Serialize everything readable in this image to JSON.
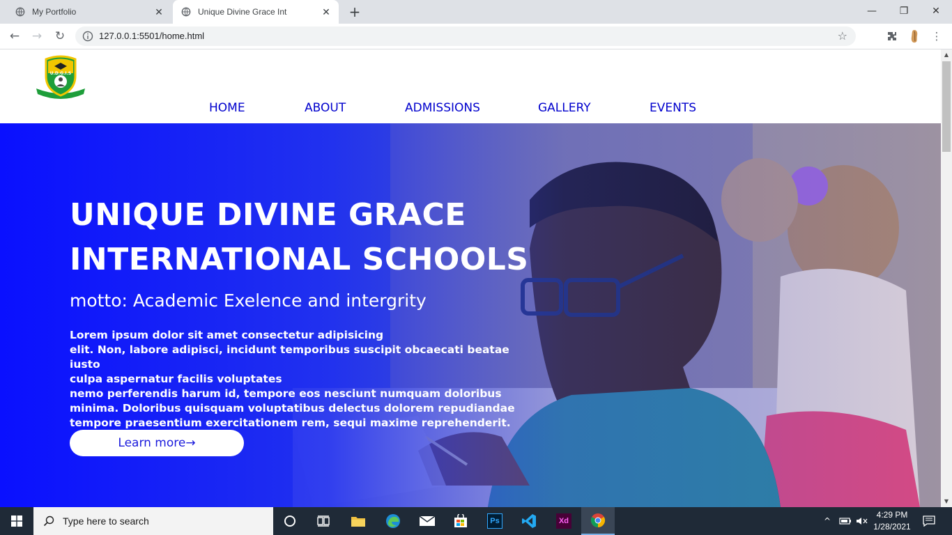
{
  "browser": {
    "tabs": [
      {
        "title": "My Portfolio",
        "active": false
      },
      {
        "title": "Unique Divine Grace Int",
        "active": true
      }
    ],
    "url": "127.0.0.1:5501/home.html"
  },
  "site": {
    "logo_text": "U.D.G.I.S",
    "nav": [
      "HOME",
      "ABOUT",
      "ADMISSIONS",
      "GALLERY",
      "EVENTS"
    ],
    "hero": {
      "title_line1": "UNIQUE DIVINE GRACE",
      "title_line2": "INTERNATIONAL SCHOOLS",
      "motto": "motto: Academic Exelence and intergrity",
      "body_lines": [
        "Lorem ipsum dolor sit amet consectetur adipisicing",
        "elit. Non, labore adipisci, incidunt temporibus suscipit obcaecati beatae iusto",
        "culpa aspernatur facilis voluptates",
        "nemo perferendis harum id, tempore eos nesciunt numquam doloribus",
        "minima. Doloribus quisquam voluptatibus delectus dolorem repudiandae",
        "tempore praesentium exercitationem rem, sequi maxime reprehenderit."
      ],
      "button": "Learn more→"
    }
  },
  "taskbar": {
    "search_placeholder": "Type here to search",
    "time": "4:29 PM",
    "date": "1/28/2021",
    "apps": [
      "cortana-icon",
      "task-view-icon",
      "file-explorer-icon",
      "edge-icon",
      "mail-icon",
      "store-icon",
      "photoshop-icon",
      "vscode-icon",
      "adobe-xd-icon",
      "chrome-icon"
    ],
    "ps_label": "Ps",
    "xd_label": "Xd"
  },
  "colors": {
    "nav_link": "#0000cd",
    "hero_overlay": "#0a14f0",
    "taskbar": "#1f2a37"
  }
}
